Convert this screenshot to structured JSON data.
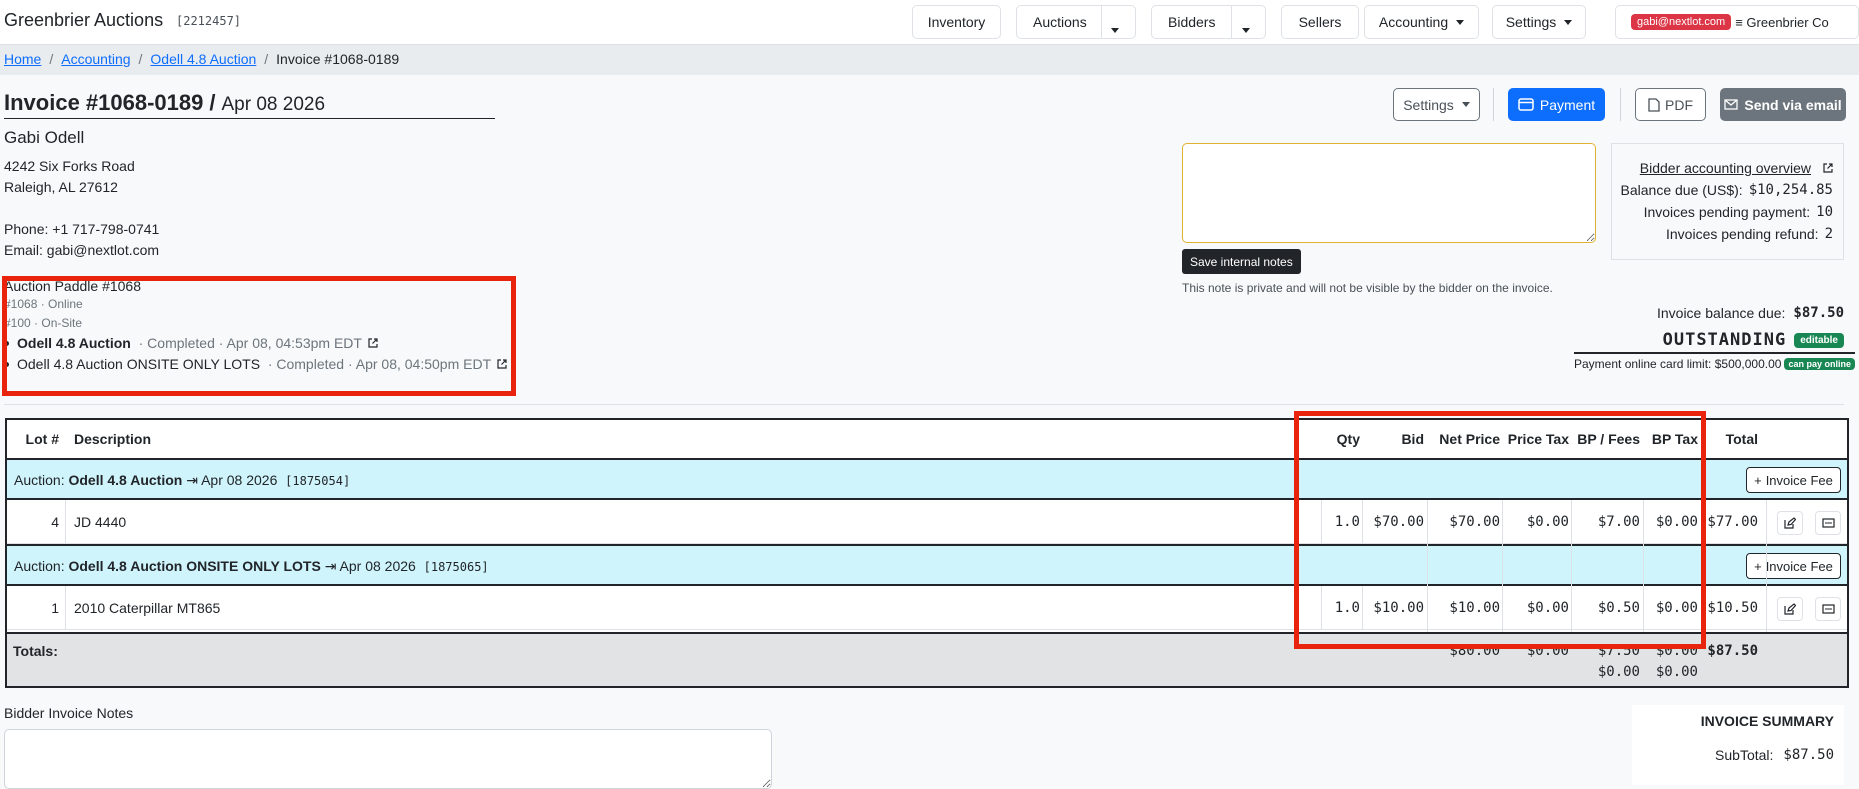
{
  "navbar": {
    "brand": "Greenbrier Auctions",
    "brand_id": "[2212457]",
    "items": {
      "inventory": "Inventory",
      "auctions": "Auctions",
      "bidders": "Bidders",
      "sellers": "Sellers",
      "accounting": "Accounting",
      "settings": "Settings"
    },
    "account_email": "gabi@nextlot.com",
    "account_company": "≡ Greenbrier Co"
  },
  "breadcrumb": {
    "home": "Home",
    "accounting": "Accounting",
    "auction": "Odell 4.8 Auction",
    "current": "Invoice #1068-0189"
  },
  "invoice": {
    "number": "Invoice #1068-0189",
    "slash": "/",
    "date": "Apr 08 2026"
  },
  "actions": {
    "settings": "Settings",
    "payment": "Payment",
    "pdf": "PDF",
    "send_email": "Send via email"
  },
  "customer": {
    "name": "Gabi Odell",
    "address1": "4242 Six Forks Road",
    "address2": "Raleigh, AL 27612",
    "phone": "Phone: +1 717-798-0741",
    "email": "Email: gabi@nextlot.com"
  },
  "paddle": {
    "title": "Auction Paddle #1068",
    "online": "#1068 · Online",
    "onsite": "#100 · On-Site",
    "auctions": [
      {
        "name": "Odell 4.8 Auction",
        "meta": "· Completed · Apr 08, 04:53pm EDT"
      },
      {
        "name": "Odell 4.8 Auction ONSITE ONLY LOTS",
        "meta": "· Completed · Apr 08, 04:50pm EDT"
      }
    ]
  },
  "internal_notes": {
    "value": "",
    "save_label": "Save internal notes",
    "hint": "This note is private and will not be visible by the bidder on the invoice."
  },
  "overview": {
    "link": "Bidder accounting overview",
    "balance_label": "Balance due (US$):",
    "balance_value": "$10,254.85",
    "pending_payment_label": "Invoices pending payment:",
    "pending_payment_value": "10",
    "pending_refund_label": "Invoices pending refund:",
    "pending_refund_value": "2"
  },
  "status": {
    "balance_label": "Invoice balance due:",
    "balance_value": "$87.50",
    "state": "OUTSTANDING",
    "state_badge": "editable",
    "limit_label": "Payment online card limit: $500,000.00",
    "limit_badge": "can pay online"
  },
  "table": {
    "headers": {
      "lot": "Lot #",
      "description": "Description",
      "qty": "Qty",
      "bid": "Bid",
      "net": "Net Price",
      "price_tax": "Price Tax",
      "bp": "BP / Fees",
      "bp_tax": "BP Tax",
      "total": "Total"
    },
    "invoice_fee_label": "Invoice Fee",
    "groups": [
      {
        "prefix": "Auction:",
        "name": "Odell 4.8 Auction",
        "arrow": "⇥",
        "date": "Apr 08 2026",
        "id": "[1875054]",
        "row": {
          "lot": "4",
          "description": "JD 4440",
          "qty": "1.0",
          "bid": "$70.00",
          "net": "$70.00",
          "price_tax": "$0.00",
          "bp": "$7.00",
          "bp_tax": "$0.00",
          "total": "$77.00"
        }
      },
      {
        "prefix": "Auction:",
        "name": "Odell 4.8 Auction ONSITE ONLY LOTS",
        "arrow": "⇥",
        "date": "Apr 08 2026",
        "id": "[1875065]",
        "row": {
          "lot": "1",
          "description": "2010 Caterpillar MT865",
          "qty": "1.0",
          "bid": "$10.00",
          "net": "$10.00",
          "price_tax": "$0.00",
          "bp": "$0.50",
          "bp_tax": "$0.00",
          "total": "$10.50"
        }
      }
    ],
    "totals": {
      "label": "Totals:",
      "net": "$80.00",
      "price_tax": "$0.00",
      "bp": "$7.50",
      "bp2": "$0.00",
      "bp_tax": "$0.00",
      "bp_tax2": "$0.00",
      "total": "$87.50"
    }
  },
  "bidder_notes": {
    "label": "Bidder Invoice Notes",
    "value": ""
  },
  "summary": {
    "title": "INVOICE SUMMARY",
    "subtotal_label": "SubTotal:",
    "subtotal_value": "$87.50"
  },
  "colors": {
    "primary": "#0d6efd",
    "highlight": "#e8240c",
    "group_bg": "#cff4fc",
    "success": "#198754",
    "danger": "#dc3545"
  }
}
